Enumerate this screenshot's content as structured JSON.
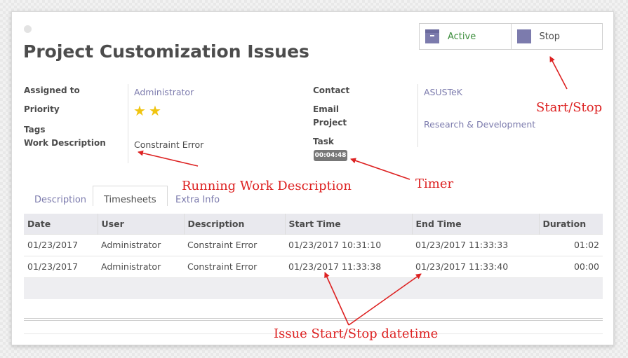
{
  "form": {
    "title": "Project Customization Issues"
  },
  "buttons": {
    "active": {
      "label": "Active",
      "color": "#3c8e3c"
    },
    "stop": {
      "label": "Stop"
    }
  },
  "fields": {
    "assigned_to": {
      "label": "Assigned to",
      "value": "Administrator"
    },
    "priority": {
      "label": "Priority",
      "stars": 2
    },
    "tags": {
      "label": "Tags"
    },
    "work_description": {
      "label": "Work Description",
      "value": "Constraint Error"
    },
    "contact": {
      "label": "Contact",
      "value": "ASUSTeK"
    },
    "email": {
      "label": "Email"
    },
    "project": {
      "label": "Project",
      "value": "Research & Development"
    },
    "task": {
      "label": "Task"
    },
    "timer": {
      "value": "00:04:48"
    }
  },
  "tabs": [
    {
      "label": "Description",
      "active": false
    },
    {
      "label": "Timesheets",
      "active": true
    },
    {
      "label": "Extra Info",
      "active": false
    }
  ],
  "timesheets": {
    "columns": [
      "Date",
      "User",
      "Description",
      "Start Time",
      "End Time",
      "Duration"
    ],
    "rows": [
      [
        "01/23/2017",
        "Administrator",
        "Constraint Error",
        "01/23/2017 10:31:10",
        "01/23/2017 11:33:33",
        "01:02"
      ],
      [
        "01/23/2017",
        "Administrator",
        "Constraint Error",
        "01/23/2017 11:33:38",
        "01/23/2017 11:33:40",
        "00:00"
      ]
    ]
  },
  "annotations": {
    "start_stop": "Start/Stop",
    "running_work": "Running Work Description",
    "timer": "Timer",
    "issue_datetime": "Issue Start/Stop datetime",
    "color": "#dd2222"
  }
}
